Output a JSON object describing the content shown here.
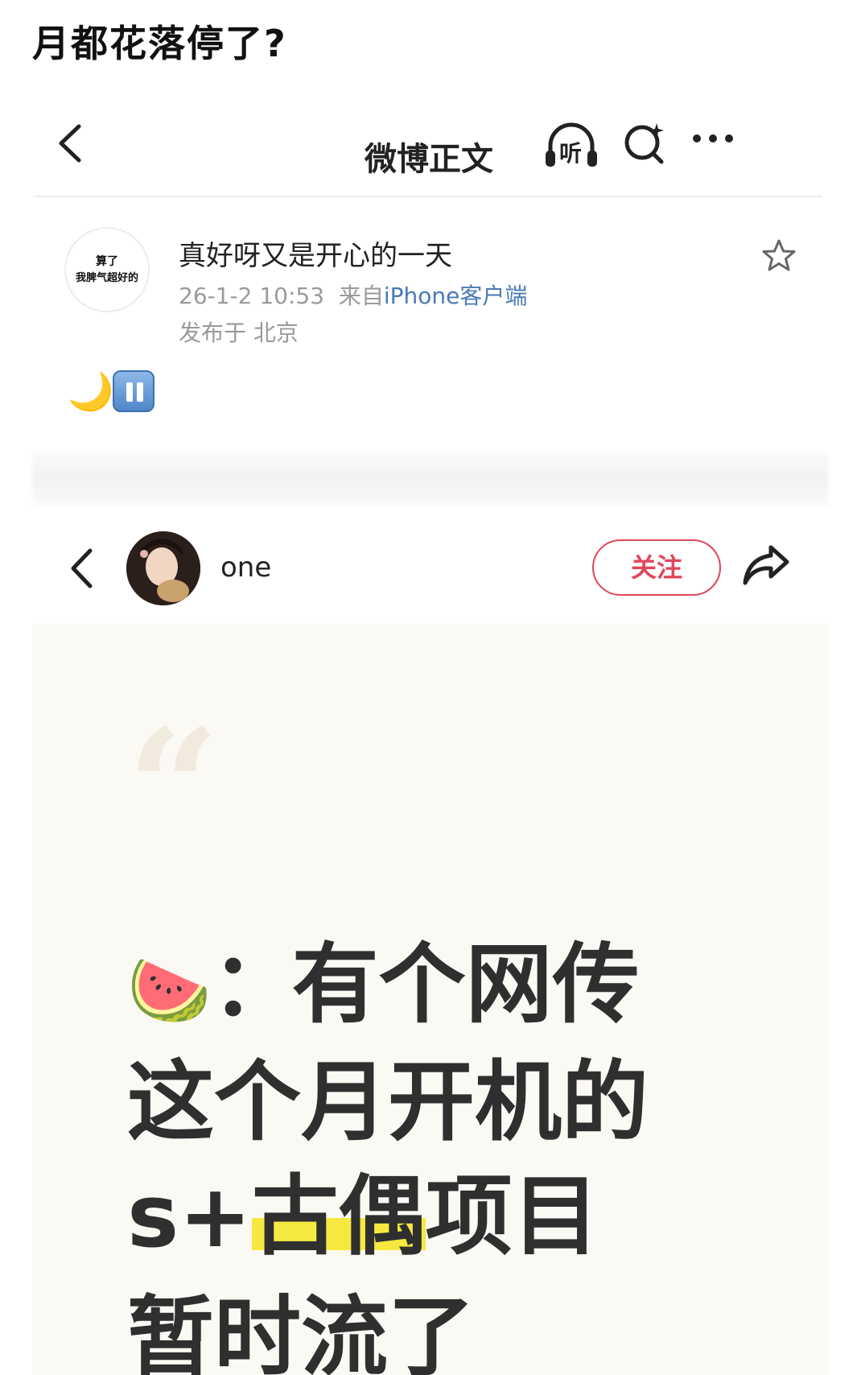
{
  "caption": "月都花落停了?",
  "weibo_nav": {
    "title": "微博正文",
    "listen_label": "听"
  },
  "post": {
    "avatar_line1": "算了",
    "avatar_line2": "我脾气超好的",
    "title": "真好呀又是开心的一天",
    "datetime": "26-1-2 10:53",
    "from_prefix": "来自",
    "source": "iPhone客户端",
    "location": "发布于 北京",
    "emoji": "🌙"
  },
  "profile_nav": {
    "username": "one",
    "follow_label": "关注"
  },
  "card": {
    "quote_mark": "“",
    "emoji": "🍉",
    "colon": "：",
    "line1_rest": "有个网传",
    "line2": "这个月开机的",
    "line3_prefix": "s+",
    "line3_highlight": "古偶",
    "line3_suffix": "项目",
    "line4": "暂时流了"
  },
  "colors": {
    "accent_red": "#e0475a",
    "link_blue": "#4a7ab5",
    "highlight_yellow": "#f5e93f",
    "card_bg": "#fbf9f4"
  },
  "icons": [
    "chevron-left-icon",
    "listen-icon",
    "search-sparkle-icon",
    "more-icon",
    "star-icon",
    "share-icon",
    "pause-icon"
  ]
}
